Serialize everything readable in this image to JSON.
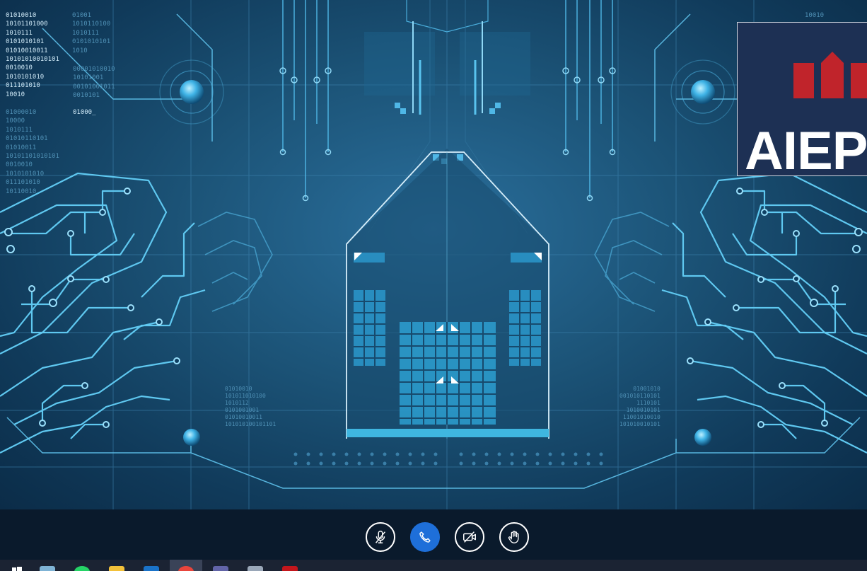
{
  "meeting": {
    "logo_text": "AIEP",
    "colors": {
      "background": "#1c5478",
      "circuit_line": "#4fb7e6",
      "logo_background": "#1d3054",
      "logo_roof": "#c0242b",
      "control_bar": "#0a1a2c",
      "primary_button": "#1e6fd9",
      "taskbar": "#1b2333"
    }
  },
  "background_text": {
    "left_bright": "01010010\n10101101000\n1010111\n0101010101\n01010010011\n10101010010101\n0010010\n1010101010\n011101010\n10010",
    "left_dim": "01001\n1010110100\n1010111\n0101010101\n1010",
    "left_dim_2": "01000010\n10000\n1010111\n01010110101\n01010011\n10101101010101\n0010010\n1010101010\n011101010\n10110010",
    "left_bright_2": "01000_",
    "left_mid_dim": "00001010010\n10101001\n00101001011\n0010101",
    "lower_left": "01010010\n101011010100\n1010112\n0101001001\n01010010011\n101010100101101",
    "lower_right": "01001010\n001010110101\n1110101\n1010010101\n11001010010\n101010010101",
    "top_right": "10010"
  },
  "controls": [
    {
      "name": "mute-mic-button",
      "icon": "mic-off-icon"
    },
    {
      "name": "hang-up-button",
      "icon": "phone-icon"
    },
    {
      "name": "camera-off-button",
      "icon": "camera-off-icon"
    },
    {
      "name": "raise-hand-button",
      "icon": "hand-icon"
    }
  ],
  "taskbar": [
    {
      "name": "windows-start",
      "icon": "windows-icon",
      "color": "#ffffff"
    },
    {
      "name": "notepad",
      "icon": "notepad-icon",
      "color": "#7fb3d5"
    },
    {
      "name": "whatsapp",
      "icon": "whatsapp-icon",
      "color": "#25d366"
    },
    {
      "name": "file-explorer",
      "icon": "folder-icon",
      "color": "#f3c13a"
    },
    {
      "name": "outlook",
      "icon": "outlook-icon",
      "color": "#1a73c9"
    },
    {
      "name": "chrome",
      "icon": "chrome-icon",
      "color": "#e8453c",
      "active": true
    },
    {
      "name": "teams",
      "icon": "teams-icon",
      "color": "#6264a7"
    },
    {
      "name": "notes",
      "icon": "notes-icon",
      "color": "#9aa7b8"
    },
    {
      "name": "acrobat",
      "icon": "acrobat-icon",
      "color": "#c4161c"
    }
  ]
}
